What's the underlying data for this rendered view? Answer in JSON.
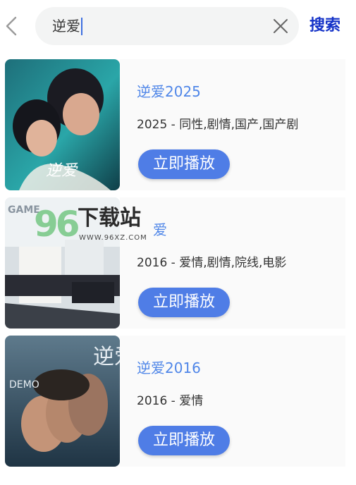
{
  "search": {
    "query": "逆爱",
    "button_label": "搜索"
  },
  "results": [
    {
      "title": "逆爱2025",
      "meta": "2025 - 同性,剧情,国产,国产剧",
      "play_label": "立即播放",
      "poster_text": "逆爱"
    },
    {
      "title": "爱",
      "meta": "2016 - 爱情,剧情,院线,电影",
      "play_label": "立即播放",
      "poster_text": "GAME"
    },
    {
      "title": "逆爱2016",
      "meta": "2016 - 爱情",
      "play_label": "立即播放",
      "poster_text": "DEMO",
      "poster_title": "逆爱"
    }
  ],
  "watermark": {
    "number": "96",
    "name": "下载站",
    "url": "WWW.96XZ.COM"
  },
  "colors": {
    "accent": "#4f7de6",
    "title": "#4f86e8",
    "search_button": "#1533c8"
  }
}
